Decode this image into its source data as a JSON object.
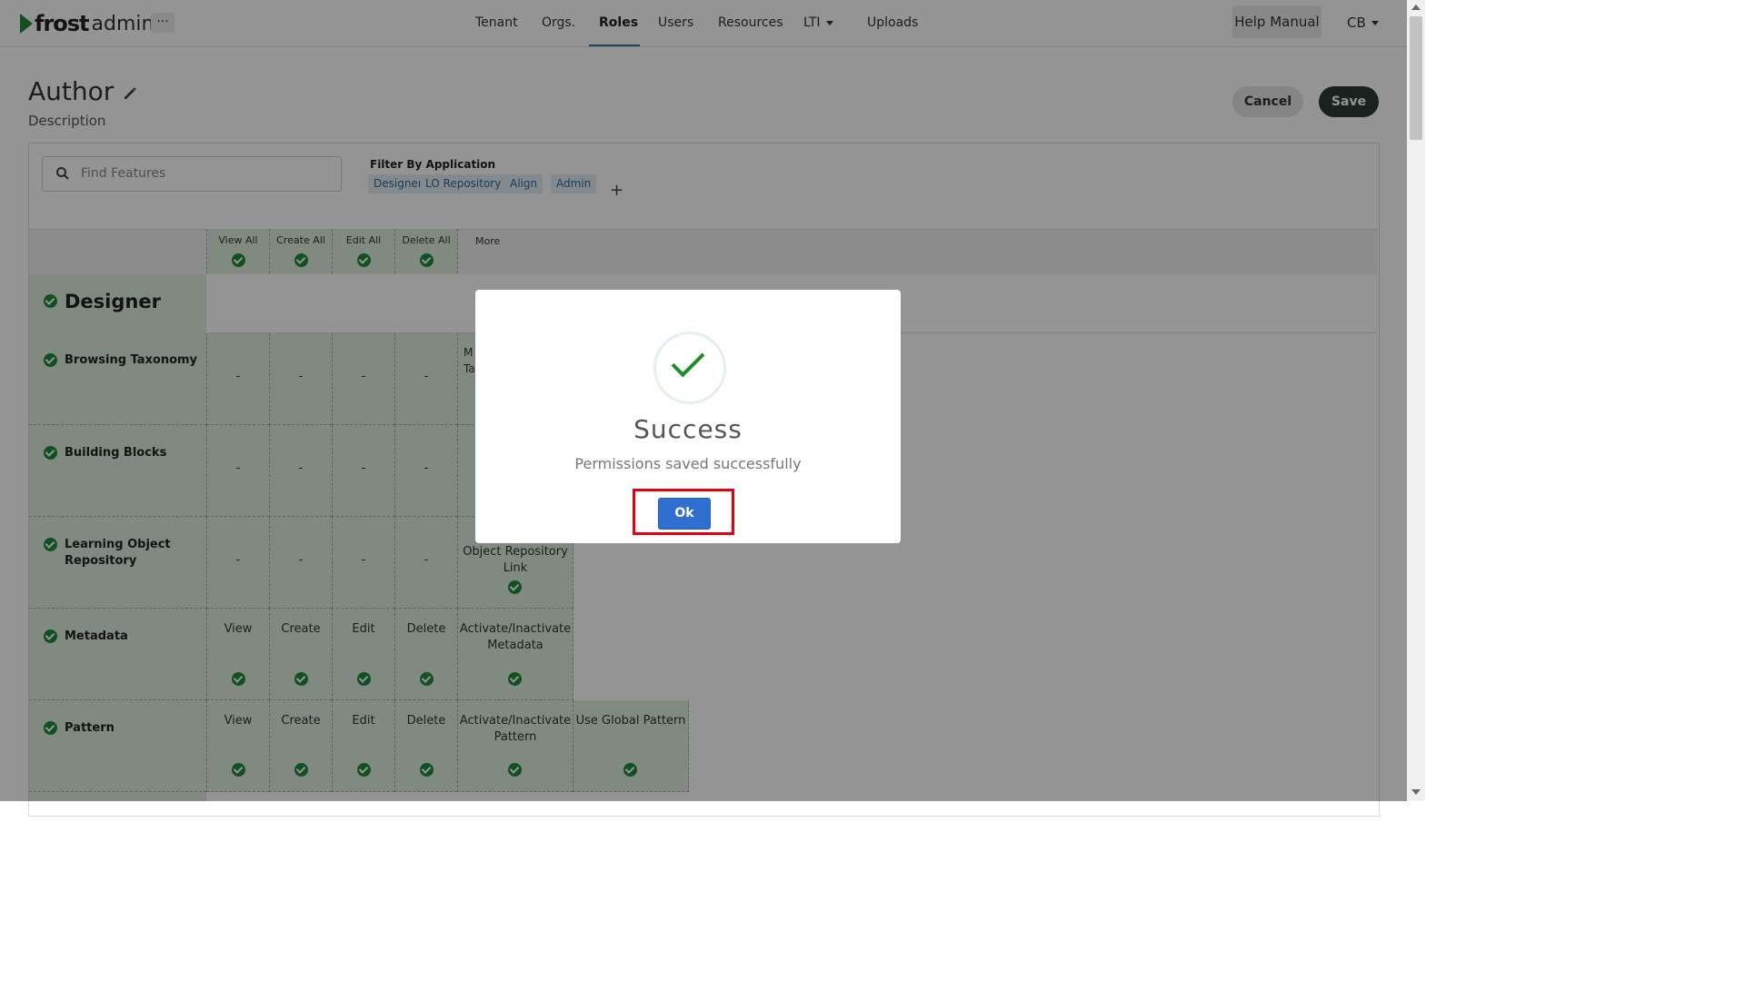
{
  "header": {
    "logo_frost": "frost",
    "logo_admin": "admin",
    "more_label": "···",
    "nav": [
      "Tenant",
      "Orgs.",
      "Roles",
      "Users",
      "Resources",
      "LTI",
      "Uploads"
    ],
    "active_nav": "Roles",
    "help_label": "Help Manual",
    "user_initials": "CB"
  },
  "page": {
    "title": "Author",
    "description": "Description",
    "cancel_label": "Cancel",
    "save_label": "Save"
  },
  "filters": {
    "search_placeholder": "Find Features",
    "filter_label": "Filter By Application",
    "chips": [
      "Designer",
      "LO Repository",
      "Align",
      "Admin"
    ],
    "add_icon": "+"
  },
  "grid": {
    "head": [
      "View All",
      "Create All",
      "Edit All",
      "Delete All",
      "More"
    ],
    "section": "Designer",
    "rows": [
      {
        "name": "Browsing Taxonomy",
        "cells": [
          "-",
          "-",
          "-",
          "-"
        ],
        "more_partial": "M\nTa"
      },
      {
        "name": "Building Blocks",
        "cells": [
          "-",
          "-",
          "-",
          "-"
        ]
      },
      {
        "name": "Learning Object Repository",
        "cells": [
          "-",
          "-",
          "-",
          "-"
        ],
        "more": "Object Repository Link"
      },
      {
        "name": "Metadata",
        "cells": [
          "View",
          "Create",
          "Edit",
          "Delete"
        ],
        "more": "Activate/Inactivate Metadata"
      },
      {
        "name": "Pattern",
        "cells": [
          "View",
          "Create",
          "Edit",
          "Delete"
        ],
        "more": "Activate/Inactivate Pattern",
        "extra": "Use Global Pattern"
      }
    ]
  },
  "modal": {
    "title": "Success",
    "message": "Permissions saved successfully",
    "ok_label": "Ok"
  },
  "colors": {
    "accent_green": "#1f8a3a",
    "ok_blue": "#2f6fcf",
    "highlight_red": "#e3000f"
  }
}
